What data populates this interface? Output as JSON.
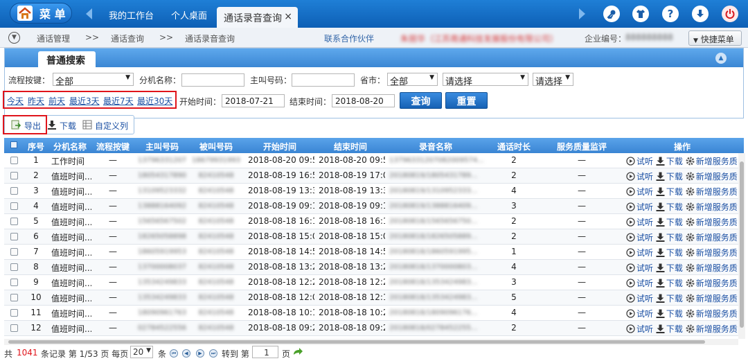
{
  "topbar": {
    "menu_label": "菜 单",
    "tabs": [
      "我的工作台",
      "个人桌面"
    ],
    "active_tab": "通话录音查询",
    "close_glyph": "×",
    "icons": [
      "key-icon",
      "shirt-icon",
      "help-icon",
      "download-icon",
      "power-icon"
    ]
  },
  "crumbs": {
    "items": [
      "通话管理",
      "通话查询",
      "通话录音查询"
    ],
    "sep": ">>",
    "partner": "联系合作伙伴",
    "company_name_redacted": "朱丽华（江苏南通科技发展股份有限公司）",
    "company_id_label": "企业编号：",
    "company_id_redacted": "888888888",
    "quick_menu": "快捷菜单"
  },
  "search": {
    "tab_label": "普通搜索",
    "flow_key_label": "流程按键：",
    "flow_key_value": "全部",
    "ext_name_label": "分机名称：",
    "caller_label": "主叫号码：",
    "province_label": "省市：",
    "province_value": "全部",
    "city_value": "请选择",
    "district_value": "请选择",
    "date_links": [
      "今天",
      "昨天",
      "前天",
      "最近3天",
      "最近7天",
      "最近30天"
    ],
    "start_label": "开始时间：",
    "start_value": "2018-07-21",
    "end_label": "结束时间：",
    "end_value": "2018-08-20",
    "query_btn": "查询",
    "reset_btn": "重置"
  },
  "toolbar": {
    "export": "导出",
    "download": "下载",
    "custom_cols": "自定义列"
  },
  "grid": {
    "columns": [
      "序号",
      "分机名称",
      "流程按键",
      "主叫号码",
      "被叫号码",
      "开始时间",
      "结束时间",
      "录音名称",
      "通话时长",
      "服务质量监评",
      "操作"
    ],
    "op_listen": "试听",
    "op_download": "下载",
    "op_add": "新增服务质",
    "rows": [
      {
        "no": "1",
        "ext": "工作时间",
        "key": "—",
        "caller": "13796331207",
        "callee": "18679931993",
        "start": "2018-08-20 09:5...",
        "end": "2018-08-20 09:5...",
        "rec": "13796331207082009574...",
        "dur": "2",
        "qa": "—"
      },
      {
        "no": "2",
        "ext": "值班时间...",
        "key": "—",
        "caller": "18054317890",
        "callee": "82410548",
        "start": "2018-08-19 16:5...",
        "end": "2018-08-19 17:0...",
        "rec": "20180819/1805431789...",
        "dur": "2",
        "qa": "—"
      },
      {
        "no": "3",
        "ext": "值班时间...",
        "key": "—",
        "caller": "13109523332",
        "callee": "82410548",
        "start": "2018-08-19 13:3...",
        "end": "2018-08-19 13:3...",
        "rec": "20180819/1310952333...",
        "dur": "4",
        "qa": "—"
      },
      {
        "no": "4",
        "ext": "值班时间...",
        "key": "—",
        "caller": "13888164092",
        "callee": "82410548",
        "start": "2018-08-19 09:1...",
        "end": "2018-08-19 09:1...",
        "rec": "20180819/1388816409...",
        "dur": "3",
        "qa": "—"
      },
      {
        "no": "5",
        "ext": "值班时间...",
        "key": "—",
        "caller": "15656567502",
        "callee": "82410548",
        "start": "2018-08-18 16:1...",
        "end": "2018-08-18 16:1...",
        "rec": "20180818/1565656750...",
        "dur": "2",
        "qa": "—"
      },
      {
        "no": "6",
        "ext": "值班时间...",
        "key": "—",
        "caller": "18265058898",
        "callee": "82410548",
        "start": "2018-08-18 15:0...",
        "end": "2018-08-18 15:0...",
        "rec": "20180818/1826505889...",
        "dur": "2",
        "qa": "—"
      },
      {
        "no": "7",
        "ext": "值班时间...",
        "key": "—",
        "caller": "18605919953",
        "callee": "82410548",
        "start": "2018-08-18 14:5...",
        "end": "2018-08-18 14:5...",
        "rec": "20180818/1860591995...",
        "dur": "1",
        "qa": "—"
      },
      {
        "no": "8",
        "ext": "值班时间...",
        "key": "—",
        "caller": "13700008037",
        "callee": "82410548",
        "start": "2018-08-18 13:2...",
        "end": "2018-08-18 13:2...",
        "rec": "20180818/1370000803...",
        "dur": "4",
        "qa": "—"
      },
      {
        "no": "9",
        "ext": "值班时间...",
        "key": "—",
        "caller": "13534249833",
        "callee": "82410548",
        "start": "2018-08-18 12:2...",
        "end": "2018-08-18 12:2...",
        "rec": "20180818/1353424983...",
        "dur": "3",
        "qa": "—"
      },
      {
        "no": "10",
        "ext": "值班时间...",
        "key": "—",
        "caller": "13534249833",
        "callee": "82410548",
        "start": "2018-08-18 12:0...",
        "end": "2018-08-18 12:1...",
        "rec": "20180818/1353424983...",
        "dur": "5",
        "qa": "—"
      },
      {
        "no": "11",
        "ext": "值班时间...",
        "key": "—",
        "caller": "18090961763",
        "callee": "82410548",
        "start": "2018-08-18 10:1...",
        "end": "2018-08-18 10:2...",
        "rec": "20180818/1809096176...",
        "dur": "4",
        "qa": "—"
      },
      {
        "no": "12",
        "ext": "值班时间...",
        "key": "—",
        "caller": "02784522556",
        "callee": "82410548",
        "start": "2018-08-18 09:2...",
        "end": "2018-08-18 09:2...",
        "rec": "20180818/0278452255...",
        "dur": "2",
        "qa": "—"
      }
    ]
  },
  "pager": {
    "total_prefix": "共",
    "total": "1041",
    "total_suffix": "条记录 第 1/53 页 每页",
    "per_page": "20",
    "per_page_suffix": "条",
    "goto_label": "转到 第",
    "goto_value": "1",
    "page_suffix": "页"
  },
  "colors": {
    "accent": "#1a5da8",
    "highlight": "#e0141b",
    "total_count": "#e0141b"
  }
}
